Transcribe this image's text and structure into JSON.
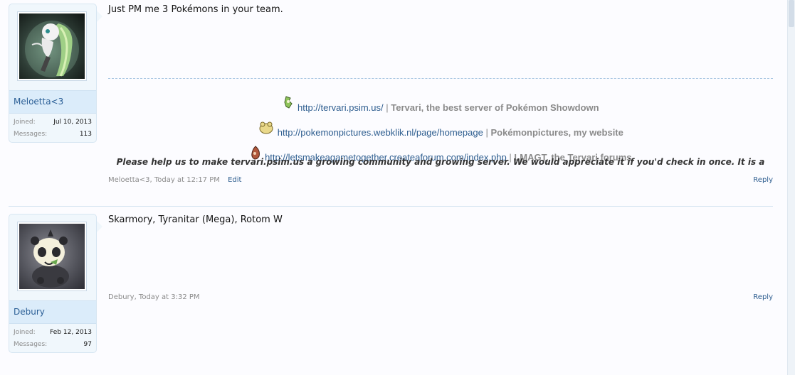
{
  "posts": [
    {
      "username": "Meloetta<3",
      "joined_label": "Joined:",
      "joined_value": "Jul 10, 2013",
      "messages_label": "Messages:",
      "messages_value": "113",
      "message": "Just PM me 3 Pokémons in your team.",
      "signature": {
        "links": [
          {
            "url": "http://tervari.psim.us/",
            "sep": "|",
            "desc": "Tervari, the best server of Pokémon Showdown",
            "sprite": "grass-pokemon-sprite-icon"
          },
          {
            "url": "http://pokemonpictures.webklik.nl/page/homepage",
            "sep": "|",
            "desc": "Pokémonpictures, my website",
            "sprite": "yellow-pokemon-sprite-icon"
          },
          {
            "url": "http://letsmakeagametogether.createaforum.com/index.php",
            "sep": "|",
            "desc": "LMAGT, the Tervari forums",
            "sprite": "red-pokemon-sprite-icon"
          }
        ],
        "bold_text": "Please help us to make tervari.psim.us a growing community and growing server. We would appreciate it if you'd check in once. It is a"
      },
      "meta": "Meloetta<3, Today at 12:17 PM",
      "edit_label": "Edit",
      "reply_label": "Reply"
    },
    {
      "username": "Debury",
      "joined_label": "Joined:",
      "joined_value": "Feb 12, 2013",
      "messages_label": "Messages:",
      "messages_value": "97",
      "message": "Skarmory, Tyranitar (Mega), Rotom W",
      "meta": "Debury, Today at 3:32 PM",
      "reply_label": "Reply"
    }
  ]
}
